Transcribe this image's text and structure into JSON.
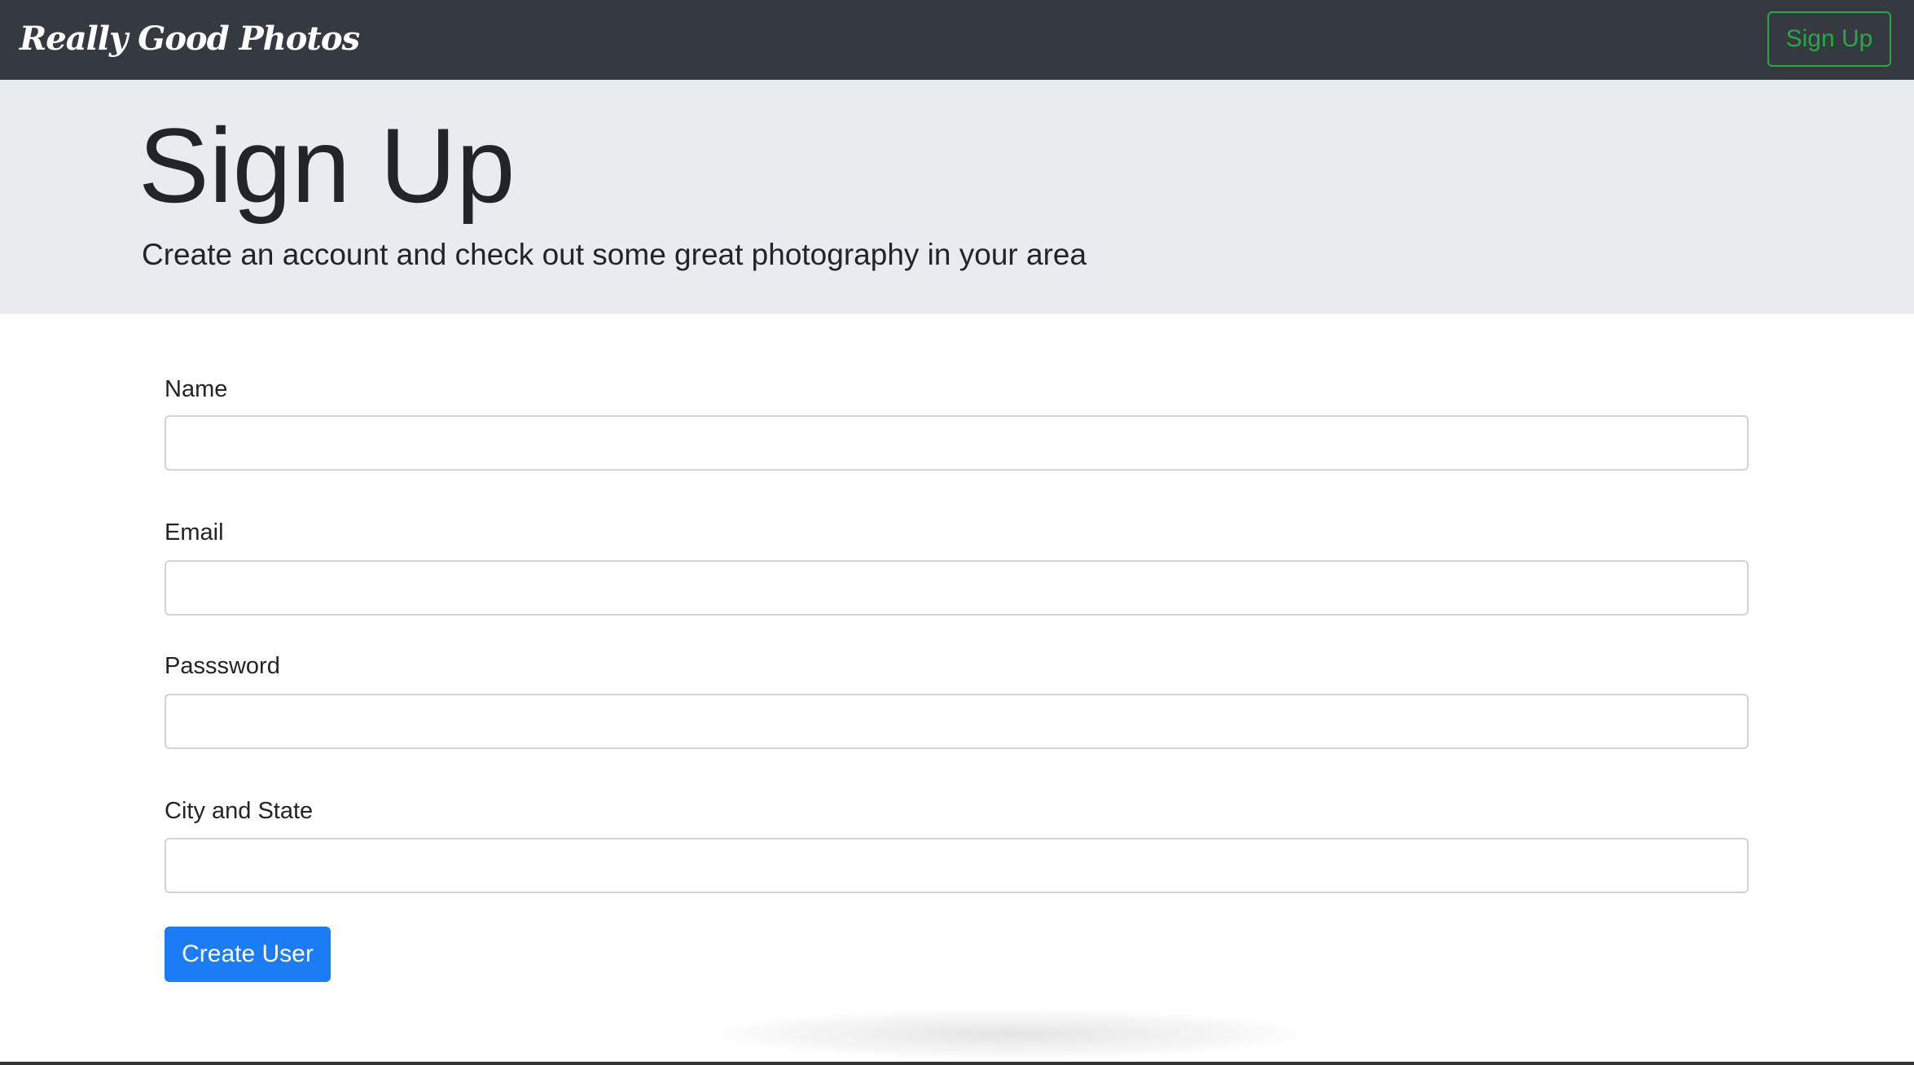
{
  "navbar": {
    "brand": "Really Good Photos",
    "signup_label": "Sign Up"
  },
  "jumbotron": {
    "title": "Sign Up",
    "lead": "Create an account and check out some great photography in your area"
  },
  "form": {
    "fields": [
      {
        "label": "Name",
        "value": ""
      },
      {
        "label": "Email",
        "value": ""
      },
      {
        "label": "Passsword",
        "value": ""
      },
      {
        "label": "City and State",
        "value": ""
      }
    ],
    "submit_label": "Create User"
  },
  "colors": {
    "navbar_bg": "#343a40",
    "jumbotron_bg": "#e9ecef",
    "success": "#28a745",
    "primary": "#1b7cf6"
  }
}
